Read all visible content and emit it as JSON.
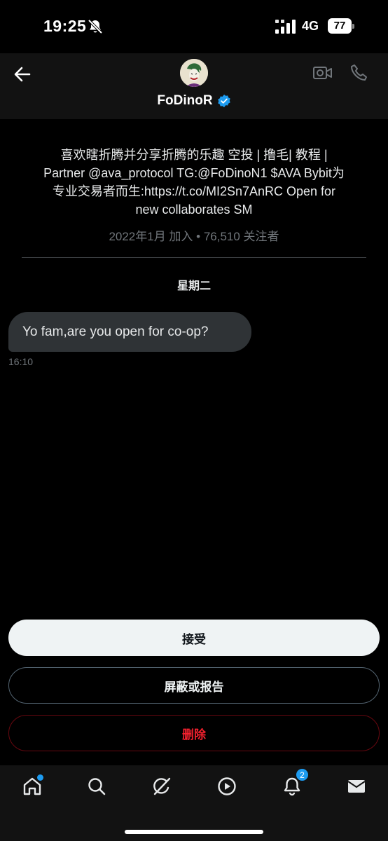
{
  "status_bar": {
    "time": "19:25",
    "network": "4G",
    "battery": "77",
    "icons": [
      "bell-muted-icon",
      "signal-icon"
    ]
  },
  "header": {
    "display_name": "FoDinoR",
    "icons": [
      "back-arrow-icon",
      "verified-badge-icon",
      "video-call-icon",
      "phone-icon"
    ]
  },
  "profile": {
    "bio": "喜欢瞎折腾并分享折腾的乐趣 空投 | 撸毛| 教程 |\nPartner @ava_protocol  TG:@FoDinoN1 $AVA Bybit为\n专业交易者而生:https://t.co/MI2Sn7AnRC Open for\nnew collaborates SM",
    "joined_line": "2022年1月 加入 • 76,510 关注者"
  },
  "conversation": {
    "day_label": "星期二",
    "messages": [
      {
        "text": "Yo fam,are you open for co-op?",
        "time": "16:10"
      }
    ]
  },
  "actions": {
    "accept_label": "接受",
    "block_report_label": "屏蔽或报告",
    "delete_label": "删除"
  },
  "tab_bar": {
    "tabs": [
      "home-icon",
      "search-icon",
      "grok-icon",
      "video-icon",
      "notifications-icon",
      "messages-icon"
    ],
    "notifications_badge": "2"
  },
  "colors": {
    "accent": "#1d9bf0",
    "background": "#000000",
    "bar_background": "#121212",
    "bubble": "#2f3336",
    "danger": "#f4212e"
  }
}
